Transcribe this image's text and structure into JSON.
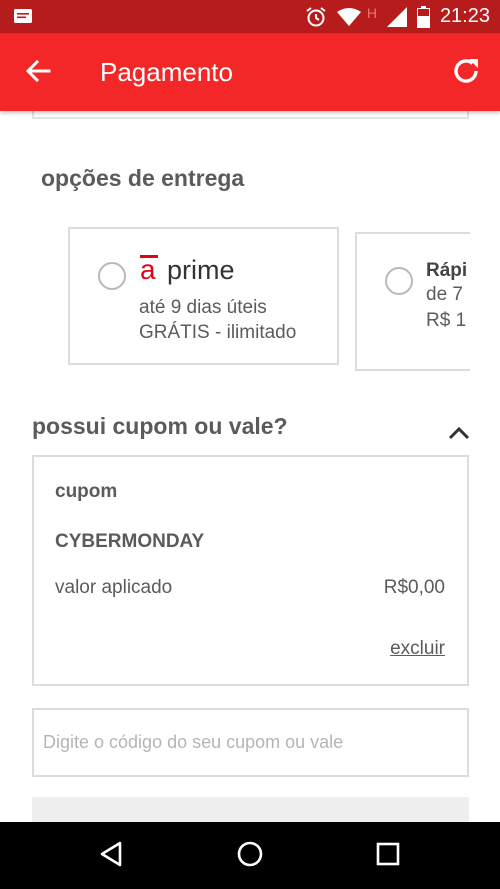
{
  "status_bar": {
    "time": "21:23",
    "network_label": "H",
    "icons": [
      "message-icon",
      "alarm-icon",
      "wifi-icon",
      "signal-icon",
      "battery-icon"
    ]
  },
  "app_bar": {
    "title": "Pagamento",
    "background": "#f32727",
    "icons": [
      "arrow-back-icon",
      "refresh-icon"
    ]
  },
  "delivery": {
    "title": "opções de entrega",
    "options": [
      {
        "logo_letter": "a",
        "name": "prime",
        "line1": "até 9 dias úteis",
        "line2": "GRÁTIS - ilimitado",
        "selected": false
      },
      {
        "name": "Rápi",
        "line1": "de 7",
        "line2": "R$ 1",
        "selected": false
      }
    ]
  },
  "coupon": {
    "title": "possui cupom ou vale?",
    "label": "cupom",
    "code": "CYBERMONDAY",
    "applied_label": "valor aplicado",
    "applied_value": "R$0,00",
    "remove_link": "excluir",
    "input_placeholder": "Digite o código do seu cupom ou vale",
    "input_value": ""
  },
  "nav_bar": {
    "icons": [
      "nav-back-icon",
      "nav-home-icon",
      "nav-recents-icon"
    ]
  },
  "colors": {
    "status_bar": "#b71c1c",
    "app_bar": "#f32727",
    "brand_red": "#e60014",
    "text_gray": "#5b5b5b"
  }
}
